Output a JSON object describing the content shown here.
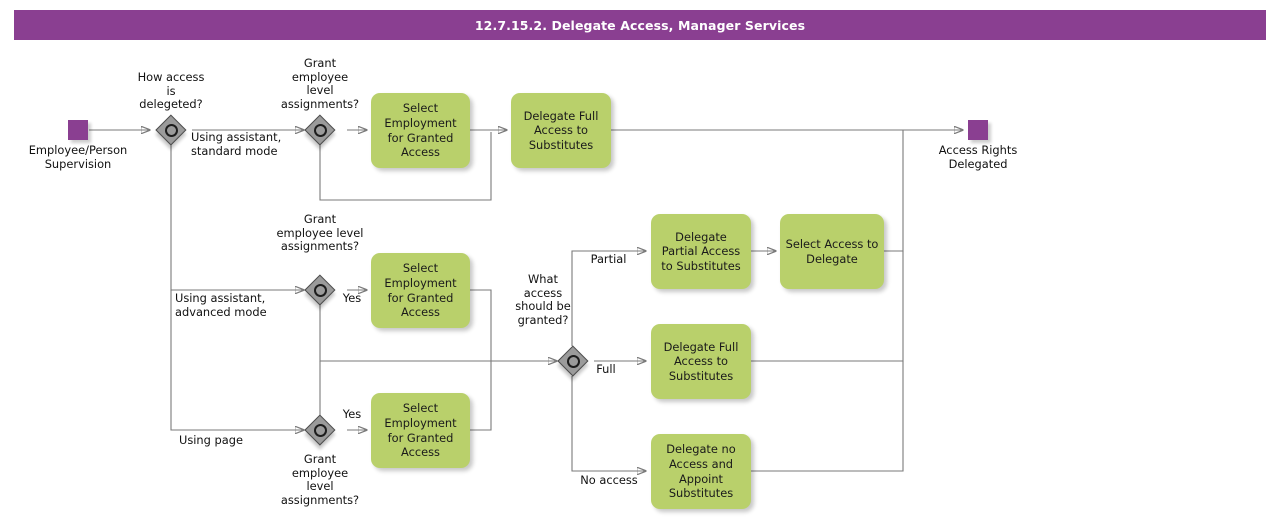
{
  "header": {
    "title": "12.7.15.2. Delegate Access, Manager Services",
    "bar_color": "#8a3f91"
  },
  "theme": {
    "task_fill": "#b9d06b",
    "event_fill": "#8a3f91",
    "gateway_fill": "#9b9b9b",
    "connector_stroke": "#7a7a7a",
    "canvas": "#ffffff"
  },
  "diagram": {
    "type": "bpmn-flowchart",
    "events": [
      {
        "id": "start",
        "name": "Employee/Person Supervision",
        "label": "Employee/Person\nSupervision",
        "kind": "start"
      },
      {
        "id": "end",
        "name": "Access Rights Delegated",
        "label": "Access Rights\nDelegated",
        "kind": "end"
      }
    ],
    "gateways": [
      {
        "id": "gw-how-access",
        "label": "How access\nis\ndelegeted?",
        "kind": "event-based"
      },
      {
        "id": "gw-grant-std",
        "label": "Grant\nemployee\nlevel\nassignments?",
        "kind": "event-based"
      },
      {
        "id": "gw-grant-adv",
        "label": "Grant\nemployee level\nassignments?",
        "kind": "event-based"
      },
      {
        "id": "gw-grant-page",
        "label": "Grant\nemployee\nlevel\nassignments?",
        "kind": "event-based"
      },
      {
        "id": "gw-what-access",
        "label": "What\naccess\nshould be\ngranted?",
        "kind": "event-based"
      }
    ],
    "tasks": [
      {
        "id": "task-select-emp-1",
        "label": "Select\nEmployment for\nGranted Access"
      },
      {
        "id": "task-delegate-full-1",
        "label": "Delegate Full\nAccess to\nSubstitutes"
      },
      {
        "id": "task-select-emp-2",
        "label": "Select\nEmployment for\nGranted Access"
      },
      {
        "id": "task-select-emp-3",
        "label": "Select\nEmployment for\nGranted Access"
      },
      {
        "id": "task-delegate-partial",
        "label": "Delegate Partial\nAccess to\nSubstitutes"
      },
      {
        "id": "task-select-access",
        "label": "Select Access\nto Delegate"
      },
      {
        "id": "task-delegate-full-2",
        "label": "Delegate Full\nAccess to\nSubstitutes"
      },
      {
        "id": "task-delegate-no-access",
        "label": "Delegate no\nAccess and\nAppoint\nSubstitutes"
      }
    ],
    "flow_labels": [
      {
        "id": "flow-standard-mode",
        "text": "Using assistant,\nstandard mode"
      },
      {
        "id": "flow-advanced-mode",
        "text": "Using assistant,\nadvanced mode"
      },
      {
        "id": "flow-using-page",
        "text": "Using page"
      },
      {
        "id": "flow-yes-adv",
        "text": "Yes"
      },
      {
        "id": "flow-yes-page",
        "text": "Yes"
      },
      {
        "id": "flow-partial",
        "text": "Partial"
      },
      {
        "id": "flow-full",
        "text": "Full"
      },
      {
        "id": "flow-no-access",
        "text": "No access"
      }
    ]
  }
}
